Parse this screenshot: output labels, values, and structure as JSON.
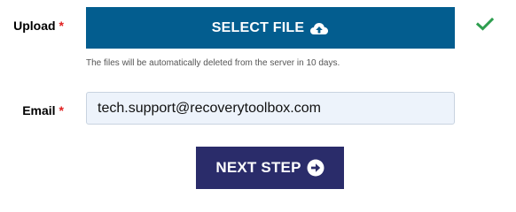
{
  "upload": {
    "label": "Upload",
    "required_mark": "*",
    "button_label": "SELECT FILE",
    "button_icon": "cloud-upload-icon",
    "status_icon": "check-icon",
    "hint": "The files will be automatically deleted from the server in 10 days."
  },
  "email": {
    "label": "Email",
    "required_mark": "*",
    "value": "tech.support@recoverytoolbox.com"
  },
  "next": {
    "button_label": "NEXT STEP",
    "button_icon": "arrow-right-circle-icon"
  },
  "colors": {
    "select_button_bg": "#035d8f",
    "next_button_bg": "#2a2c6a",
    "required_mark": "#e02020",
    "check": "#2e9e4f",
    "input_bg": "#edf3fb"
  }
}
